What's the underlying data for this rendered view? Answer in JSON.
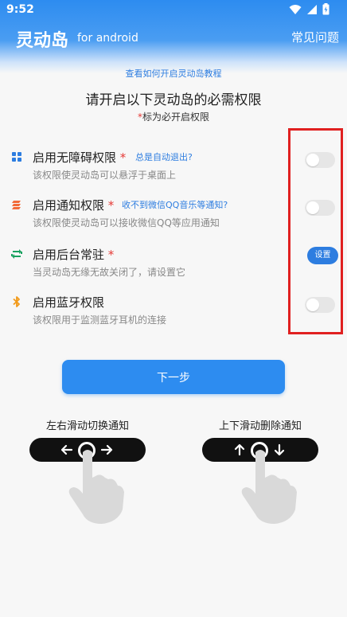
{
  "status_bar": {
    "time": "9:52"
  },
  "header": {
    "title": "灵动岛",
    "subtitle": "for android",
    "faq": "常见问题"
  },
  "tutorial_link": "查看如何开启灵动岛教程",
  "main_title": "请开启以下灵动岛的必需权限",
  "required_note": {
    "star": "*",
    "text": "标为必开启权限"
  },
  "permissions": [
    {
      "title": "启用无障碍权限",
      "star": "*",
      "hint": "总是自动退出?",
      "desc": "该权限使灵动岛可以悬浮于桌面上",
      "control": "toggle",
      "enabled": false,
      "icon": "grid-icon",
      "icon_color": "#2d7de0"
    },
    {
      "title": "启用通知权限",
      "star": "*",
      "hint": "收不到微信QQ音乐等通知?",
      "desc": "该权限使灵动岛可以接收微信QQ等应用通知",
      "control": "toggle",
      "enabled": false,
      "icon": "notification-stack-icon",
      "icon_color": "#f26b3a"
    },
    {
      "title": "启用后台常驻",
      "star": "*",
      "hint": "",
      "desc": "当灵动岛无缘无故关闭了，请设置它",
      "control": "button",
      "button_label": "设置",
      "icon": "sync-icon",
      "icon_color": "#1aa260"
    },
    {
      "title": "启用蓝牙权限",
      "star": "",
      "hint": "",
      "desc": "该权限用于监测蓝牙耳机的连接",
      "control": "toggle",
      "enabled": false,
      "icon": "bluetooth-icon",
      "icon_color": "#f29a1a"
    }
  ],
  "next_button": "下一步",
  "gestures": {
    "left": {
      "label": "左右滑动切换通知"
    },
    "right": {
      "label": "上下滑动删除通知"
    }
  },
  "colors": {
    "primary": "#2d8cf0",
    "link": "#2d7de0",
    "required": "#e53935",
    "highlight": "#e02020"
  }
}
